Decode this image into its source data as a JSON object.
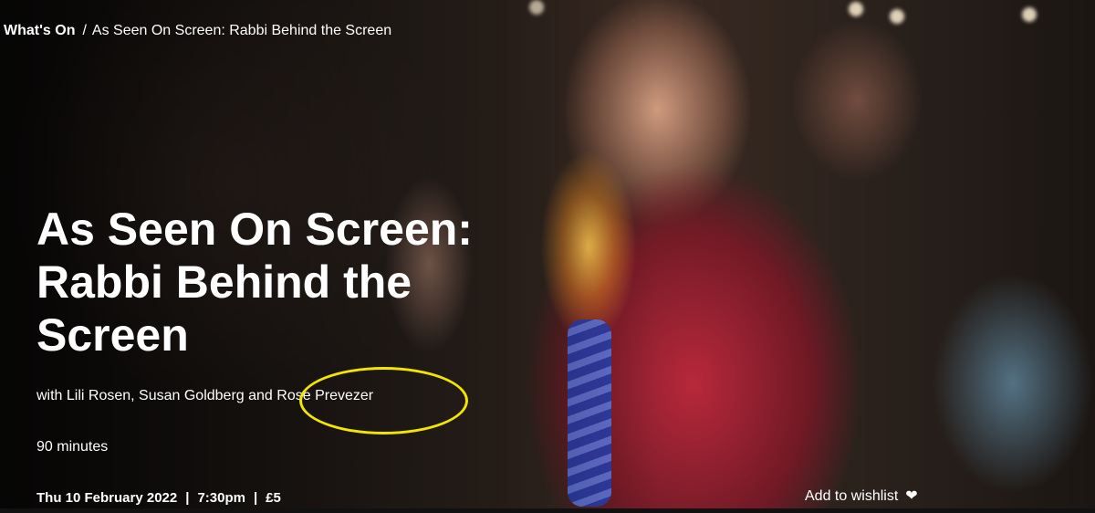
{
  "breadcrumb": {
    "parent": "What's On",
    "separator": "/",
    "current": "As Seen On Screen: Rabbi Behind the Screen"
  },
  "event": {
    "title_lines": [
      "As Seen On Screen:",
      "Rabbi Behind the",
      "Screen"
    ],
    "subtitle": "with Lili Rosen, Susan Goldberg and Rose Prevezer",
    "duration": "90 minutes",
    "date": "Thu 10 February 2022",
    "time": "7:30pm",
    "price": "£5",
    "meta_separator": "|"
  },
  "actions": {
    "wishlist_label": "Add to wishlist",
    "wishlist_icon": "heart-icon"
  },
  "colors": {
    "text": "#ffffff",
    "annotation": "#f2e600"
  }
}
